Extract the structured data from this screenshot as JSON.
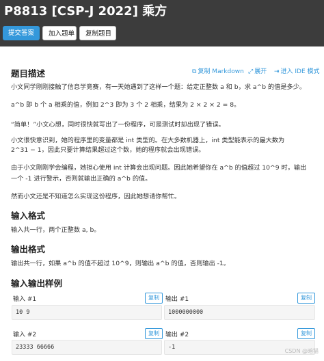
{
  "header": {
    "title": "P8813 [CSP-J 2022] 乘方",
    "buttons": {
      "submit": "提交答案",
      "add": "加入题单",
      "copy": "复制题目"
    }
  },
  "toolbar": {
    "copy_md": "复制 Markdown",
    "expand": "展开",
    "ide": "进入 IDE 模式"
  },
  "desc": {
    "heading": "题目描述",
    "p1": "小文同学刚刚接触了信息学竞赛，有一天她遇到了这样一个题：给定正整数 a 和 b，求 a^b 的值是多少。",
    "p2": "a^b 即 b 个 a 相乘的值，例如 2^3 即为 3 个 2 相乘，结果为 2 × 2 × 2 = 8。",
    "p3": "“简单！”小文心想，同时很快就写出了一份程序，可是测试时却出现了错误。",
    "p4a": "小文很快意识到，她的程序里的变量都是 int 类型的。在大多数机器上，int 类型能表示的最大数为",
    "p4b": "2^31 − 1，因此只要计算结果超过这个数，她的程序就会出现错误。",
    "p5a": "由于小文刚刚学会编程，她担心使用 int 计算会出现问题。因此她希望你在 a^b 的值超过 10^9 时，输出",
    "p5b": "一个 -1 进行警示，否则就输出正确的 a^b 的值。",
    "p6": "然而小文还是不知道怎么实现这份程序，因此她想请你帮忙。"
  },
  "input_fmt": {
    "heading": "输入格式",
    "text": "输入共一行，两个正整数 a, b。"
  },
  "output_fmt": {
    "heading": "输出格式",
    "text": "输出共一行，如果 a^b 的值不超过 10^9，则输出 a^b 的值，否则输出 -1。"
  },
  "samples": {
    "heading": "输入输出样例",
    "copy_label": "复制",
    "items": [
      {
        "in_label": "输入 #1",
        "out_label": "输出 #1",
        "input": "10 9",
        "output": "1000000000"
      },
      {
        "in_label": "输入 #2",
        "out_label": "输出 #2",
        "input": "23333 66666",
        "output": "-1"
      }
    ]
  },
  "watermark": "CSDN @暗猫"
}
